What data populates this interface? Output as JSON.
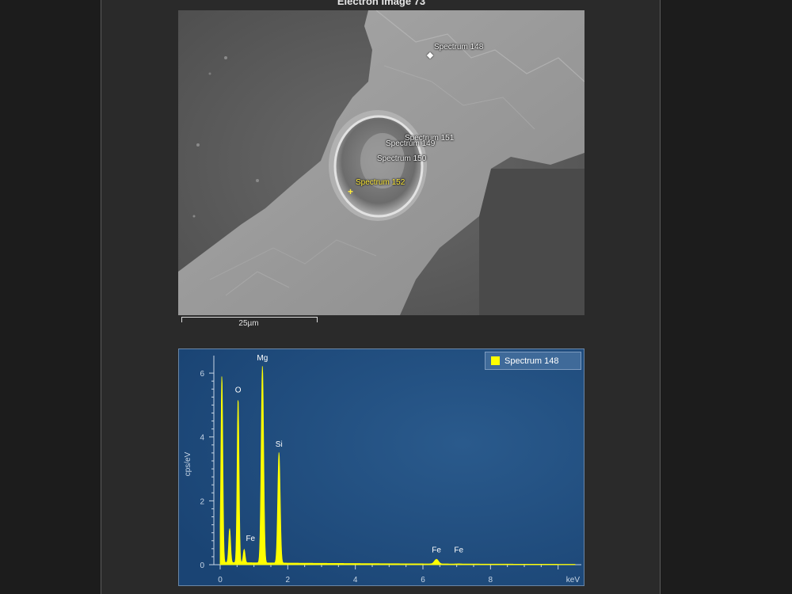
{
  "electron_image": {
    "title": "Electron Image 73",
    "scale_bar_label": "25µm",
    "spectrum_labels": [
      {
        "id": "s148",
        "text": "Spectrum 148",
        "selected": false
      },
      {
        "id": "s151",
        "text": "Spectrum 151",
        "selected": false
      },
      {
        "id": "s149",
        "text": "Spectrum 149",
        "selected": false
      },
      {
        "id": "s150",
        "text": "Spectrum 150",
        "selected": false
      },
      {
        "id": "s152",
        "text": "Spectrum 152",
        "selected": true
      }
    ]
  },
  "spectrum_plot": {
    "legend": "Spectrum 148",
    "colors": {
      "background": "#1f4d7e",
      "trace": "#ffff00",
      "axis": "#c8d6e6",
      "legend_bg": "#3f6a99"
    }
  },
  "chart_data": {
    "type": "line",
    "title": "",
    "xlabel": "keV",
    "ylabel": "cps/eV",
    "xlim": [
      0,
      10.5
    ],
    "ylim": [
      0,
      6.3
    ],
    "x_ticks": [
      0,
      2,
      4,
      6,
      8
    ],
    "y_ticks": [
      0,
      2,
      4,
      6
    ],
    "legend_position": "top-right",
    "series": [
      {
        "name": "Spectrum 148",
        "peaks": [
          {
            "x": 0.05,
            "y": 5.9,
            "label": ""
          },
          {
            "x": 0.28,
            "y": 1.1,
            "label": ""
          },
          {
            "x": 0.53,
            "y": 5.2,
            "label": "O"
          },
          {
            "x": 0.71,
            "y": 0.45,
            "label": "Fe"
          },
          {
            "x": 1.25,
            "y": 6.2,
            "label": "Mg"
          },
          {
            "x": 1.74,
            "y": 3.5,
            "label": "Si"
          },
          {
            "x": 6.4,
            "y": 0.18,
            "label": "Fe"
          },
          {
            "x": 7.06,
            "y": 0.04,
            "label": "Fe"
          }
        ],
        "background_level": 0.07
      }
    ]
  }
}
